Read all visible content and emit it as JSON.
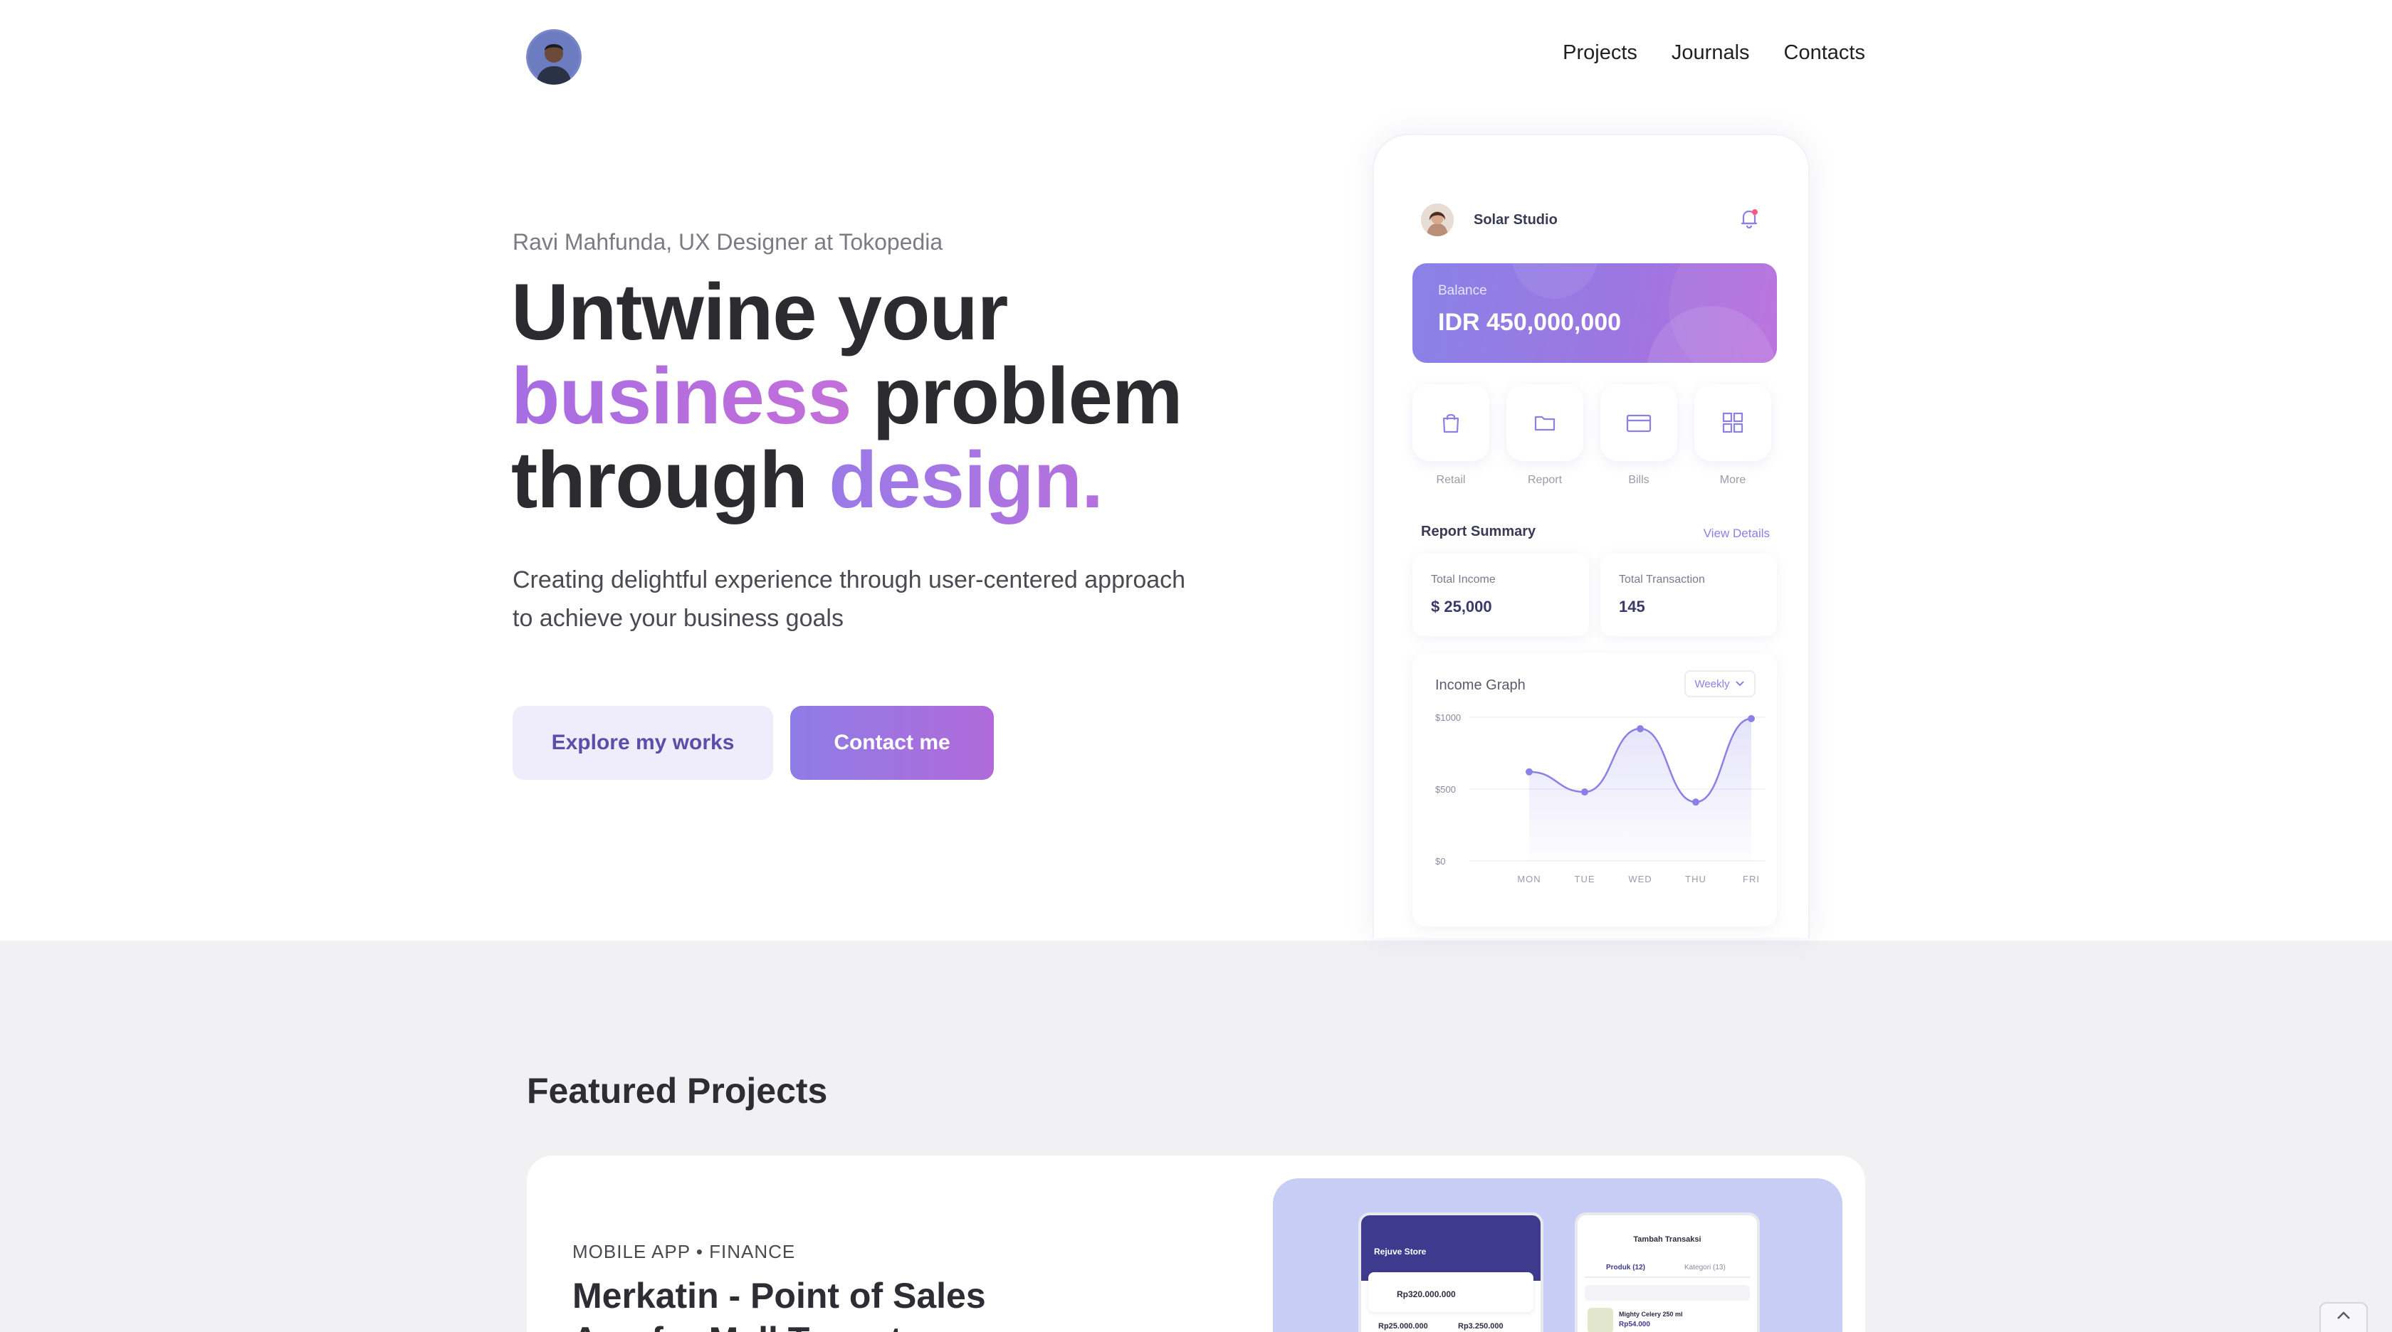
{
  "nav": {
    "links": [
      "Projects",
      "Journals",
      "Contacts"
    ]
  },
  "hero": {
    "intro": "Ravi Mahfunda, UX Designer at Tokopedia",
    "headline": {
      "line1": "Untwine your",
      "line2_highlight": "business",
      "line2_rest": " problem",
      "line3_start": "through ",
      "line3_highlight": "design."
    },
    "description_line1": "Creating delightful experience through user-centered approach",
    "description_line2": "to achieve your business goals",
    "explore_label": "Explore my works",
    "contact_label": "Contact me"
  },
  "phone": {
    "user_name": "Solar Studio",
    "balance_label": "Balance",
    "balance_value": "IDR 450,000,000",
    "quick_actions": [
      {
        "label": "Retail",
        "icon": "bag-icon"
      },
      {
        "label": "Report",
        "icon": "folder-icon"
      },
      {
        "label": "Bills",
        "icon": "card-icon"
      },
      {
        "label": "More",
        "icon": "grid-icon"
      }
    ],
    "report_summary_title": "Report Summary",
    "view_details": "View Details",
    "cards": [
      {
        "label": "Total Income",
        "value": "$ 25,000"
      },
      {
        "label": "Total Transaction",
        "value": "145"
      }
    ],
    "income_graph_title": "Income Graph",
    "period_select": "Weekly"
  },
  "chart_data": {
    "type": "area",
    "categories": [
      "MON",
      "TUE",
      "WED",
      "THU",
      "FRI"
    ],
    "values": [
      620,
      480,
      920,
      410,
      990
    ],
    "y_ticks": [
      "$1000",
      "$500",
      "$0"
    ],
    "ylim": [
      0,
      1000
    ],
    "accent": "#8b80e6"
  },
  "featured": {
    "title": "Featured Projects",
    "project_tag": "MOBILE APP • FINANCE",
    "project_title_line1": "Merkatin - Point of Sales",
    "project_title_line2": "App for Mall Tenant",
    "screen1_store": "Rejuve Store",
    "screen1_amount": "Rp320.000.000",
    "screen1_a": "Rp25.000.000",
    "screen1_b": "Rp3.250.000",
    "screen2_title": "Tambah Transaksi",
    "screen2_tab1": "Produk (12)",
    "screen2_tab2": "Kategori (13)",
    "screen2_item": "Mighty Celery 250 ml",
    "screen2_price": "Rp54.000"
  },
  "colors": {
    "accent_purple": "#8b80e6",
    "accent_pink": "#b06ad9",
    "section_bg": "#f1f1f4"
  }
}
